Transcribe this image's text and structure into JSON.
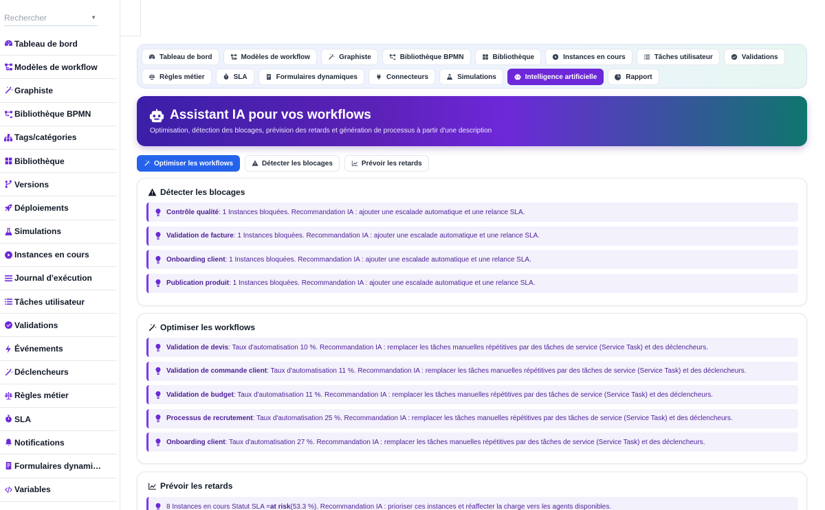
{
  "sidebar": {
    "search_placeholder": "Rechercher",
    "items": [
      {
        "label": "Tableau de bord",
        "icon": "dashboard-icon"
      },
      {
        "label": "Modèles de workflow",
        "icon": "workflow-icon"
      },
      {
        "label": "Graphiste",
        "icon": "wand-icon"
      },
      {
        "label": "Bibliothèque BPMN",
        "icon": "bpmn-icon"
      },
      {
        "label": "Tags/catégories",
        "icon": "tags-icon"
      },
      {
        "label": "Bibliothèque",
        "icon": "grid-icon"
      },
      {
        "label": "Versions",
        "icon": "branch-icon"
      },
      {
        "label": "Déploiements",
        "icon": "rocket-icon"
      },
      {
        "label": "Simulations",
        "icon": "flask-icon"
      },
      {
        "label": "Instances en cours",
        "icon": "play-circle-icon"
      },
      {
        "label": "Journal d'exécution",
        "icon": "list-icon"
      },
      {
        "label": "Tâches utilisateur",
        "icon": "tasks-icon"
      },
      {
        "label": "Validations",
        "icon": "check-circle-icon"
      },
      {
        "label": "Événements",
        "icon": "bolt-icon"
      },
      {
        "label": "Déclencheurs",
        "icon": "wand-icon"
      },
      {
        "label": "Règles métier",
        "icon": "scale-icon"
      },
      {
        "label": "SLA",
        "icon": "stopwatch-icon"
      },
      {
        "label": "Notifications",
        "icon": "bell-icon"
      },
      {
        "label": "Formulaires dynami…",
        "icon": "form-icon"
      },
      {
        "label": "Variables",
        "icon": "code-icon"
      }
    ]
  },
  "tabs": {
    "row1": [
      {
        "label": "Tableau de bord",
        "icon": "dashboard-icon"
      },
      {
        "label": "Modèles de workflow",
        "icon": "workflow-icon"
      },
      {
        "label": "Graphiste",
        "icon": "wand-icon"
      },
      {
        "label": "Bibliothèque BPMN",
        "icon": "bpmn-icon"
      },
      {
        "label": "Bibliothèque",
        "icon": "grid-icon"
      },
      {
        "label": "Instances en cours",
        "icon": "play-circle-icon"
      },
      {
        "label": "Tâches utilisateur",
        "icon": "tasks-icon"
      },
      {
        "label": "Validations",
        "icon": "check-circle-icon"
      }
    ],
    "row2": [
      {
        "label": "Règles métier",
        "icon": "scale-icon"
      },
      {
        "label": "SLA",
        "icon": "stopwatch-icon"
      },
      {
        "label": "Formulaires dynamiques",
        "icon": "form-icon"
      },
      {
        "label": "Connecteurs",
        "icon": "plug-icon"
      },
      {
        "label": "Simulations",
        "icon": "flask-icon"
      },
      {
        "label": "Intelligence artificielle",
        "icon": "robot-icon",
        "active": true
      },
      {
        "label": "Rapport",
        "icon": "pie-icon"
      }
    ]
  },
  "hero": {
    "title": "Assistant IA pour vos workflows",
    "subtitle": "Optimisation, détection des blocages, prévision des retards et génération de processus à partir d'une description"
  },
  "subtabs": [
    {
      "label": "Optimiser les workflows",
      "icon": "wand-icon",
      "active": true
    },
    {
      "label": "Détecter les blocages",
      "icon": "warning-icon"
    },
    {
      "label": "Prévoir les retards",
      "icon": "chart-line-icon"
    }
  ],
  "blocages": {
    "title": "Détecter les blocages",
    "items": [
      {
        "name": "Contrôle qualité",
        "text": " : 1 Instances bloquées. Recommandation IA : ajouter une escalade automatique et une relance SLA."
      },
      {
        "name": "Validation de facture",
        "text": " : 1 Instances bloquées. Recommandation IA : ajouter une escalade automatique et une relance SLA."
      },
      {
        "name": "Onboarding client",
        "text": " : 1 Instances bloquées. Recommandation IA : ajouter une escalade automatique et une relance SLA."
      },
      {
        "name": "Publication produit",
        "text": " : 1 Instances bloquées. Recommandation IA : ajouter une escalade automatique et une relance SLA."
      }
    ]
  },
  "optimiser": {
    "title": "Optimiser les workflows",
    "items": [
      {
        "name": "Validation de devis",
        "text": " : Taux d'automatisation 10 %. Recommandation IA : remplacer les tâches manuelles répétitives par des tâches de service (Service Task) et des déclencheurs."
      },
      {
        "name": "Validation de commande client",
        "text": " : Taux d'automatisation 11 %. Recommandation IA : remplacer les tâches manuelles répétitives par des tâches de service (Service Task) et des déclencheurs."
      },
      {
        "name": "Validation de budget",
        "text": " : Taux d'automatisation 11 %. Recommandation IA : remplacer les tâches manuelles répétitives par des tâches de service (Service Task) et des déclencheurs."
      },
      {
        "name": "Processus de recrutement",
        "text": " : Taux d'automatisation 25 %. Recommandation IA : remplacer les tâches manuelles répétitives par des tâches de service (Service Task) et des déclencheurs."
      },
      {
        "name": "Onboarding client",
        "text": " : Taux d'automatisation 27 %. Recommandation IA : remplacer les tâches manuelles répétitives par des tâches de service (Service Task) et des déclencheurs."
      }
    ]
  },
  "retards": {
    "title": "Prévoir les retards",
    "item": {
      "prefix": "8 Instances en cours Statut SLA = ",
      "status": "at risk",
      "suffix": " (53.3 %). Recommandation IA : prioriser ces instances et réaffecter la charge vers les agents disponibles."
    }
  },
  "colors": {
    "accent": "#6d28d9",
    "active_subtab": "#2563eb",
    "item_bg": "#f3f1fc",
    "item_text": "#4c1d95"
  }
}
